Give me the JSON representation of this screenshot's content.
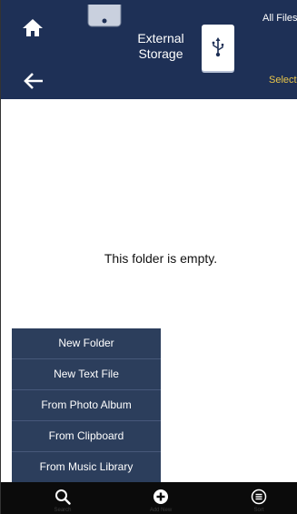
{
  "header": {
    "title_line1": "External",
    "title_line2": "Storage",
    "all_files_label": "All Files",
    "select_label": "Select",
    "accent_color": "#e8c54a",
    "background_color": "#1e3056"
  },
  "content": {
    "empty_message": "This folder is empty."
  },
  "add_menu": {
    "items": [
      {
        "label": "New Folder"
      },
      {
        "label": "New Text File"
      },
      {
        "label": "From Photo Album"
      },
      {
        "label": "From Clipboard"
      },
      {
        "label": "From Music Library"
      }
    ]
  },
  "toolbar": {
    "search_label": "Search",
    "add_new_label": "Add New",
    "sort_label": "Sort"
  }
}
